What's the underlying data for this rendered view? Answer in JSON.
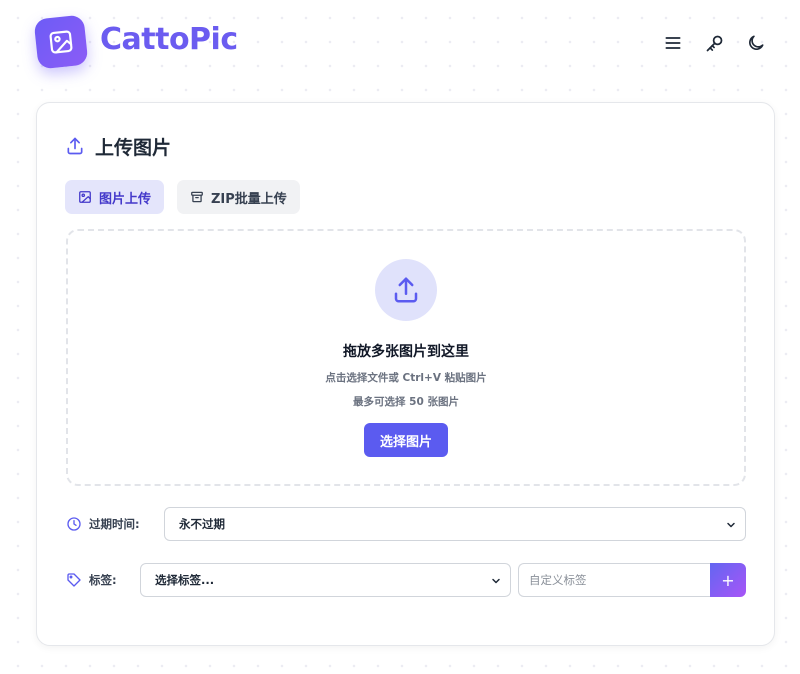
{
  "header": {
    "brand": "CattoPic",
    "logo_icon": "image-icon",
    "actions": [
      {
        "icon": "menu-icon"
      },
      {
        "icon": "key-icon"
      },
      {
        "icon": "moon-icon"
      }
    ]
  },
  "upload": {
    "title": "上传图片",
    "tabs": [
      {
        "label": "图片上传",
        "icon": "image-icon",
        "active": true
      },
      {
        "label": "ZIP批量上传",
        "icon": "archive-icon",
        "active": false
      }
    ],
    "dropzone": {
      "title": "拖放多张图片到这里",
      "hint": "点击选择文件或 Ctrl+V 粘贴图片",
      "limit": "最多可选择 50 张图片",
      "button": "选择图片"
    },
    "expiry": {
      "label": "过期时间:",
      "selected": "永不过期"
    },
    "tags": {
      "label": "标签:",
      "select_placeholder": "选择标签...",
      "custom_placeholder": "自定义标签",
      "add_label": "+"
    }
  },
  "colors": {
    "brand": "#6b5cf0",
    "primary_button": "#5b5bf0",
    "active_tab_bg": "#e4e5fb"
  }
}
